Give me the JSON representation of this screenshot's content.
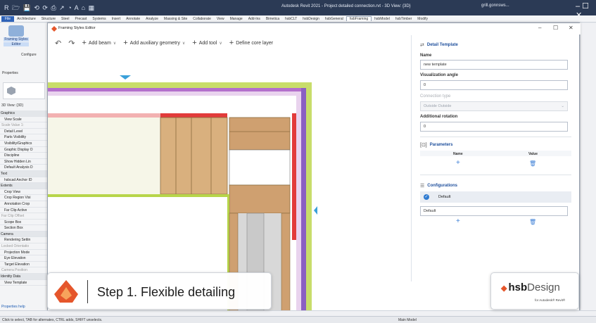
{
  "titlebar": {
    "quick_access": "R 🗁 💾 ⟲ ⟳ ⎙ ↗ ◔ A ⌂ ▦",
    "title": "Autodesk Revit 2021 - Project detailed connection.rvt - 3D View: {3D}",
    "user": "grill.gonnsws...",
    "window_controls": "–  ☐  ✕"
  },
  "ribbon_tabs": [
    "File",
    "Architecture",
    "Structure",
    "Steel",
    "Precast",
    "Systems",
    "Insert",
    "Annotate",
    "Analyze",
    "Massing & Site",
    "Collaborate",
    "View",
    "Manage",
    "Add-Ins",
    "Bimetica",
    "hsbCLT",
    "hsbDesign",
    "hsbGeneral",
    "hsbFraming",
    "hsbModel",
    "hsbTimber",
    "Modify"
  ],
  "ribbon_active": "hsbFraming",
  "left_panel": {
    "fse_label_1": "Framing Styles",
    "fse_label_2": "Editor",
    "configure": "Configure",
    "properties": "Properties",
    "view_type": "3D View: {3D}",
    "rows": [
      {
        "t": "Graphics",
        "k": "grp"
      },
      {
        "t": "View Scale",
        "k": "ind"
      },
      {
        "t": "Scale Value   1:",
        "k": "dim"
      },
      {
        "t": "Detail Level",
        "k": "ind"
      },
      {
        "t": "Parts Visibility",
        "k": "ind"
      },
      {
        "t": "Visibility/Graphics",
        "k": "ind"
      },
      {
        "t": "Graphic Display O",
        "k": "ind"
      },
      {
        "t": "Discipline",
        "k": "ind"
      },
      {
        "t": "Show Hidden Lin",
        "k": "ind"
      },
      {
        "t": "Default Analysis D",
        "k": "ind"
      },
      {
        "t": "Text",
        "k": "grp"
      },
      {
        "t": "hsbcad Anchor ID",
        "k": "ind"
      },
      {
        "t": "Extents",
        "k": "grp"
      },
      {
        "t": "Crop View",
        "k": "ind"
      },
      {
        "t": "Crop Region Visi",
        "k": "ind"
      },
      {
        "t": "Annotation Crop",
        "k": "ind"
      },
      {
        "t": "Far Clip Active",
        "k": "ind"
      },
      {
        "t": "Far Clip Offset",
        "k": "dim"
      },
      {
        "t": "Scope Box",
        "k": "ind"
      },
      {
        "t": "Section Box",
        "k": "ind"
      },
      {
        "t": "Camera",
        "k": "grp"
      },
      {
        "t": "Rendering Settin",
        "k": "ind"
      },
      {
        "t": "Locked Orientatio",
        "k": "dim"
      },
      {
        "t": "Projection Mode",
        "k": "ind"
      },
      {
        "t": "Eye Elevation",
        "k": "ind"
      },
      {
        "t": "Target Elevation",
        "k": "ind"
      },
      {
        "t": "Camera Position",
        "k": "dim"
      },
      {
        "t": "Identity Data",
        "k": "grp"
      },
      {
        "t": "View Template",
        "k": "ind"
      }
    ],
    "properties_help": "Properties help"
  },
  "dialog": {
    "title": "Framing Styles Editor",
    "controls": [
      "–",
      "☐",
      "✕"
    ],
    "toolbar": {
      "undo": "↶",
      "redo": "↷",
      "add_beam": "Add beam",
      "add_aux": "Add auxiliary geometry",
      "add_tool": "Add tool",
      "define_core": "Define core layer"
    }
  },
  "right_panel": {
    "detail_template": "Detail Template",
    "name_label": "Name",
    "name_value": "new template",
    "vis_angle_label": "Visualization angle",
    "vis_angle_value": "0",
    "conn_type_label": "Connection type",
    "conn_type_value": "Outside Outside",
    "add_rot_label": "Additional rotation",
    "add_rot_value": "0",
    "parameters": "Parameters",
    "param_name_col": "Name",
    "param_value_col": "Value",
    "configurations": "Configurations",
    "config_item": "Default",
    "config_input": "Default"
  },
  "overlay": {
    "step_text": "Step 1. Flexible detailing",
    "brand": "hsb",
    "brand_d": "Design",
    "brand_sub": "for Autodesk® Revit®"
  },
  "statusbar": {
    "hint": "Click to select, TAB for alternates, CTRL adds, SHIFT unselects.",
    "model": "Main Model"
  },
  "colors": {
    "accent": "#1e4f9c",
    "revit_title": "#2b3a55",
    "timber": "#d9b07e",
    "lime": "#b7d54a",
    "red": "#e23b3b",
    "purple": "#8a5fc3"
  }
}
